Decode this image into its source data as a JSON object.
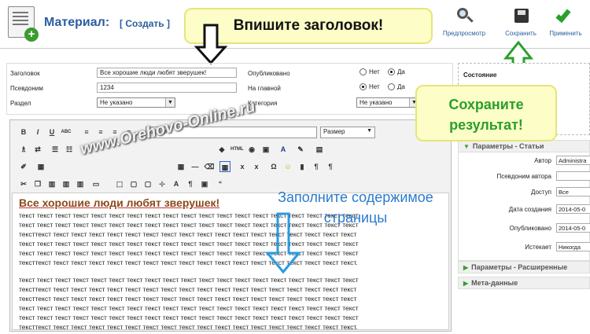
{
  "header": {
    "title": "Материал:",
    "subtitle": "[ Создать ]",
    "icon": "article-add-icon",
    "buttons": [
      {
        "label": "Предпросмотр",
        "icon": "magnifier-icon"
      },
      {
        "label": "Сохранить",
        "icon": "floppy-disk-icon"
      },
      {
        "label": "Применить",
        "icon": "checkmark-icon"
      }
    ]
  },
  "callouts": {
    "title": "Впишите заголовок!",
    "save_line1": "Сохраните",
    "save_line2": "результат!",
    "content_line1": "Заполните содержимое",
    "content_line2": "страницы"
  },
  "form": {
    "title_label": "Заголовок",
    "title_value": "Все хорошие люди любят зверушек!",
    "alias_label": "Псевдоним",
    "alias_value": "1234",
    "section_label": "Раздел",
    "section_value": "Не указано",
    "published_label": "Опубликовано",
    "frontpage_label": "На главной",
    "category_label": "Категория",
    "category_value": "Не указано",
    "no_label": "Нет",
    "yes_label": "Да"
  },
  "editor": {
    "style_label": "Стили",
    "size_label": "Размер",
    "heading": "Все хорошие люди любят зверушек!",
    "paragraph1": [
      "текст текст текст текст текст текст текст текст текст текст текст текст текст текст текст текст текст текст текст",
      "текст текст текст текст текст текст текст текст текст текст текст текст текст текст текст текст текст текст текст",
      "тексттекст текст текст текст текст текст текст текст текст текст текст текст текст текст текст текст текст текст",
      "текст текст текст текст текст текст текст текст текст текст текст текст текст текст текст текст текст текст текст",
      "текст текст текст текст текст текст текст текст текст текст текст текст текст текст текст текст текст текст текст",
      "тексттекст текст текст текст текст текст текст текст текст текст текст текст текст текст текст текст текст текст."
    ],
    "paragraph2": [
      "текст текст текст текст текст текст текст текст текст текст текст текст текст текст текст текст текст текст текст",
      "тексттекст текст текст текст текст текст текст текст текст текст текст текст текст текст текст текст текст текст",
      "тексттекст текст текст текст текст текст текст текст текст текст текст текст текст текст текст текст текст текст",
      "текст текст текст текст текст текст текст текст текст текст текст текст текст текст текст текст текст текст текст",
      "текст текст текст текст текст текст текст текст текст текст текст текст текст текст текст текст текст текст текст",
      "тексттекст текст текст текст текст текст текст текст текст текст текст текст текст текст текст текст текст текст."
    ],
    "watermark": "www.Orehovo-Online.ru"
  },
  "side": {
    "status_label": "Состояние",
    "params_article": "Параметры - Статьи",
    "rows": [
      {
        "label": "Автор",
        "value": "Administra"
      },
      {
        "label": "Псевдоним автора",
        "value": ""
      },
      {
        "label": "Доступ",
        "value": "Все"
      },
      {
        "label": "Дата создания",
        "value": "2014-05-0"
      },
      {
        "label": "Опубликовано",
        "value": "2014-05-0"
      },
      {
        "label": "Истекает",
        "value": "Никогда"
      }
    ],
    "params_extended": "Параметры - Расширенные",
    "meta": "Мета-данные"
  },
  "colors": {
    "accent": "#2a5d9e",
    "callout_bg": "#fdfdc8",
    "save_green": "#2aa02a",
    "content_blue": "#2a7acc"
  }
}
